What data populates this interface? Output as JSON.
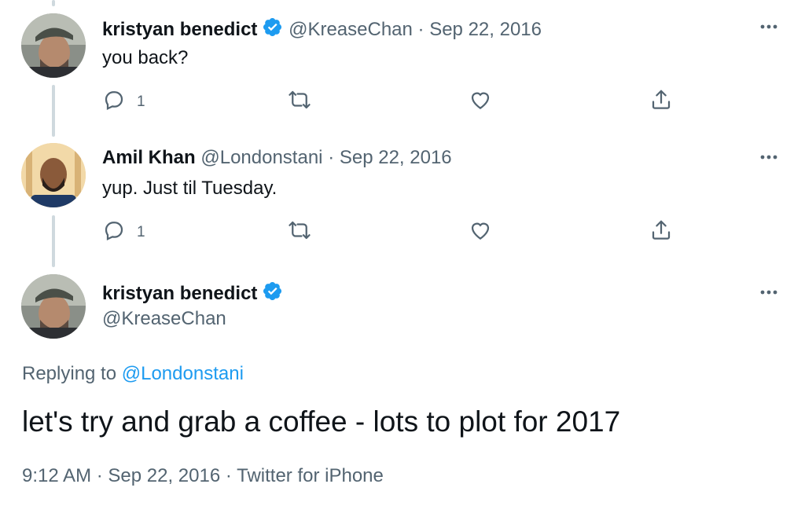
{
  "tweets": [
    {
      "name": "kristyan benedict",
      "verified": true,
      "handle": "@KreaseChan",
      "separator": "·",
      "date": "Sep 22, 2016",
      "text": "you back?",
      "reply_count": "1"
    },
    {
      "name": "Amil Khan",
      "verified": false,
      "handle": "@Londonstani",
      "separator": "·",
      "date": "Sep 22, 2016",
      "text": "yup. Just til Tuesday.",
      "reply_count": "1"
    }
  ],
  "main_tweet": {
    "name": "kristyan benedict",
    "verified": true,
    "handle": "@KreaseChan",
    "replying_prefix": "Replying to",
    "replying_to": "@Londonstani",
    "text": "let's try and grab a coffee - lots to plot for 2017",
    "time": "9:12 AM",
    "separator": "·",
    "date": "Sep 22, 2016",
    "source": "Twitter for iPhone"
  },
  "colors": {
    "accent": "#1d9bf0",
    "secondary_text": "#536471",
    "thread_line": "#cfd9de"
  },
  "icons": [
    "more-icon",
    "reply-icon",
    "retweet-icon",
    "like-icon",
    "share-icon",
    "verified-badge-icon"
  ]
}
